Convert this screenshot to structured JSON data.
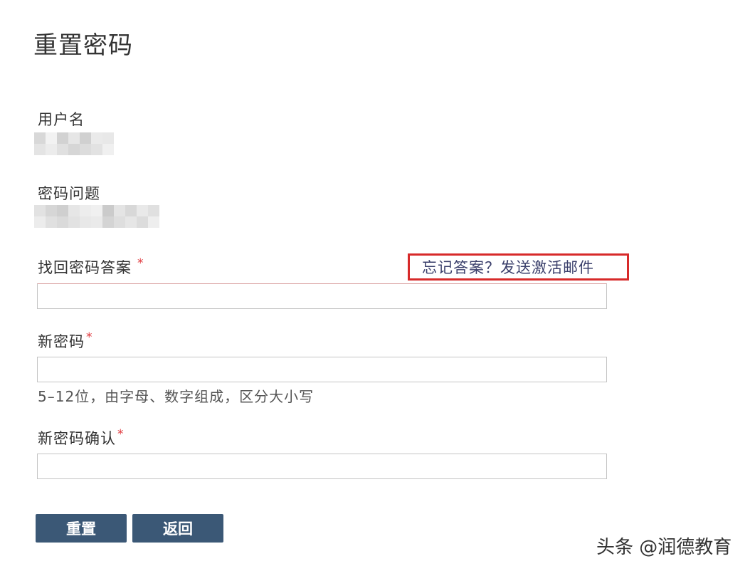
{
  "page": {
    "title": "重置密码"
  },
  "fields": {
    "username_label": "用户名",
    "question_label": "密码问题",
    "answer_label": "找回密码答案",
    "answer_required": "*",
    "forgot_link": "忘记答案？发送激活邮件",
    "new_password_label": "新密码",
    "new_password_required": "*",
    "password_hint": "5–12位，由字母、数字组成，区分大小写",
    "confirm_label": "新密码确认",
    "confirm_required": "*"
  },
  "buttons": {
    "reset": "重置",
    "back": "返回"
  },
  "watermark": "头条 @润德教育",
  "colors": {
    "button_bg": "#3b5876",
    "highlight_box": "#d72a2a",
    "required_star": "#e0393e",
    "link": "#3a3f6b"
  }
}
